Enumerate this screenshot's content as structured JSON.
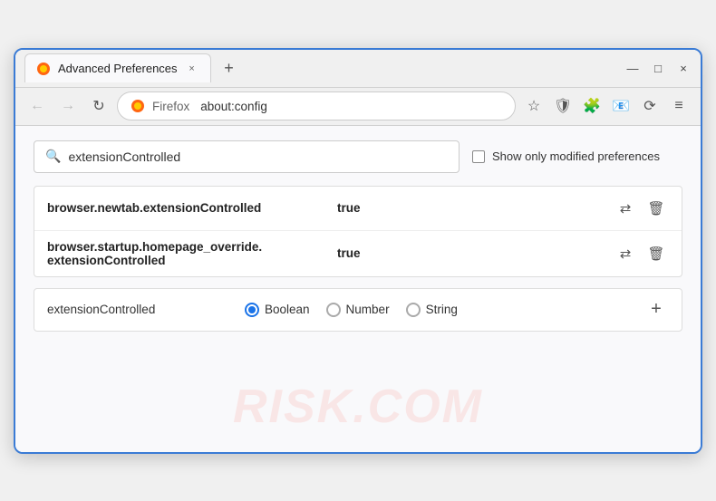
{
  "window": {
    "title": "Advanced Preferences",
    "tab_close": "×",
    "new_tab": "+",
    "win_minimize": "—",
    "win_maximize": "□",
    "win_close": "×"
  },
  "nav": {
    "back_arrow": "←",
    "forward_arrow": "→",
    "reload": "↻",
    "browser_name": "Firefox",
    "address": "about:config",
    "bookmark_icon": "☆",
    "shield_icon": "🛡",
    "extension_icon": "🧩",
    "lock_icon": "📧",
    "sync_icon": "⟳",
    "menu_icon": "≡"
  },
  "search": {
    "placeholder": "extensionControlled",
    "value": "extensionControlled",
    "search_icon": "🔍",
    "modified_label": "Show only modified preferences"
  },
  "results": [
    {
      "name": "browser.newtab.extensionControlled",
      "value": "true"
    },
    {
      "name": "browser.startup.homepage_override.\nextensionControlled",
      "name_line1": "browser.startup.homepage_override.",
      "name_line2": "extensionControlled",
      "value": "true",
      "multiline": true
    }
  ],
  "new_pref": {
    "name": "extensionControlled",
    "type_options": [
      {
        "label": "Boolean",
        "selected": true
      },
      {
        "label": "Number",
        "selected": false
      },
      {
        "label": "String",
        "selected": false
      }
    ],
    "add_label": "+"
  },
  "watermark": "RISK.COM",
  "colors": {
    "border": "#3a7bd5",
    "radio_selected": "#1a73e8"
  }
}
